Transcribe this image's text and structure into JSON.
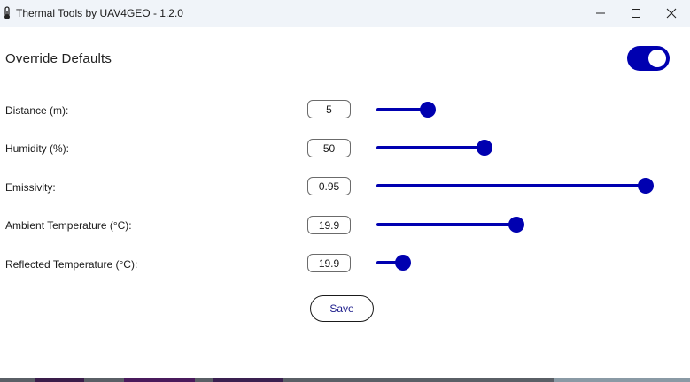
{
  "window": {
    "title": "Thermal Tools by UAV4GEO - 1.2.0",
    "icon": "thermometer-icon",
    "controls": [
      "minimize-icon",
      "maximize-icon",
      "close-icon"
    ]
  },
  "override": {
    "label": "Override Defaults",
    "enabled": true
  },
  "parameters": [
    {
      "label": "Distance (m):",
      "value": "5",
      "slider_fraction": 0.19
    },
    {
      "label": "Humidity (%):",
      "value": "50",
      "slider_fraction": 0.4
    },
    {
      "label": "Emissivity:",
      "value": "0.95",
      "slider_fraction": 1.0
    },
    {
      "label": "Ambient Temperature (°C):",
      "value": "19.9",
      "slider_fraction": 0.52
    },
    {
      "label": "Reflected Temperature (°C):",
      "value": "19.9",
      "slider_fraction": 0.1
    }
  ],
  "save_label": "Save",
  "colors": {
    "accent": "#0000b0",
    "titlebar": "#f0f4f9",
    "save_text": "#1a1a8a"
  }
}
